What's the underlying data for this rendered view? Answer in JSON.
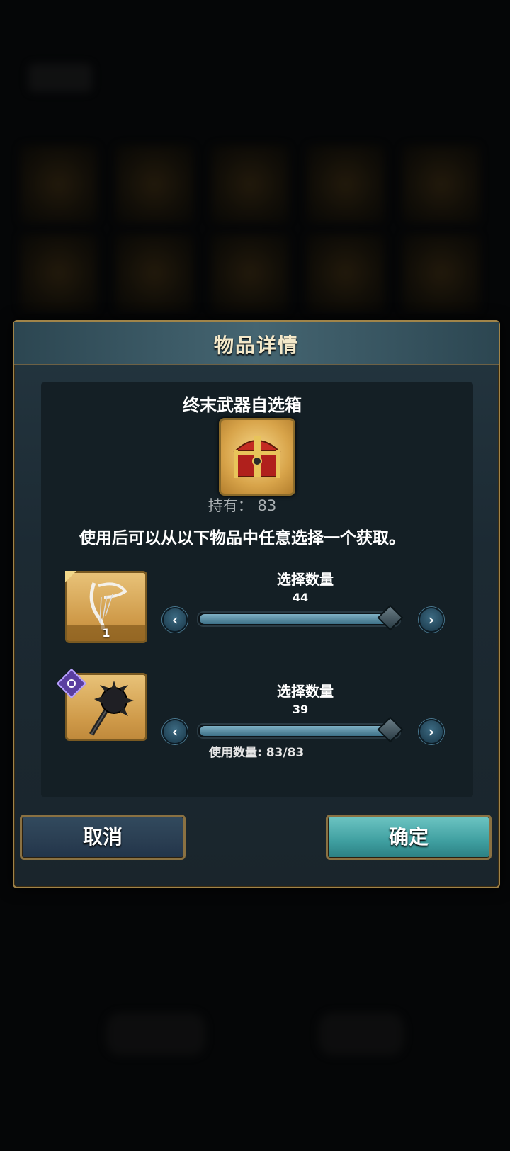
{
  "dialog": {
    "title": "物品详情",
    "item_name": "终末武器自选箱",
    "owned_text": "持有： 83",
    "description": "使用后可以从以下物品中任意选择一个获取。",
    "options": [
      {
        "slot_count": "1",
        "select_label": "选择数量",
        "select_value": "44",
        "fill_fraction": 0.96
      },
      {
        "slot_count": "",
        "select_label": "选择数量",
        "select_value": "39",
        "fill_fraction": 0.96
      }
    ],
    "used_text": "使用数量: 83/83",
    "cancel_label": "取消",
    "confirm_label": "确定"
  },
  "icons": {
    "decrease": "‹",
    "increase": "›"
  }
}
